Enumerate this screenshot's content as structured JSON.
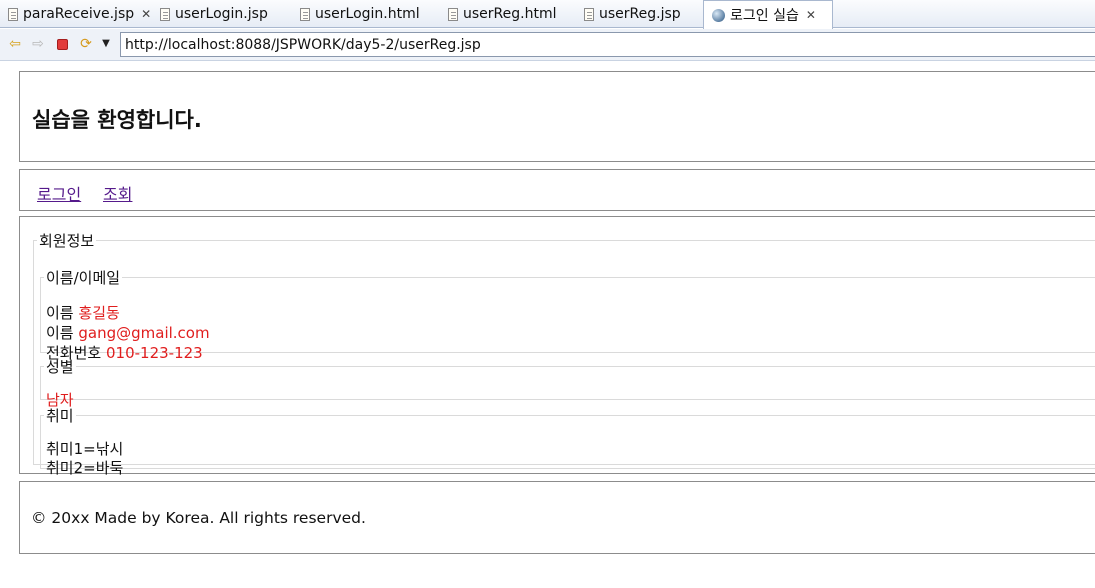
{
  "tabs": [
    {
      "label": "paraReceive.jsp",
      "icon": "file-icon",
      "closable": true,
      "active": false
    },
    {
      "label": "userLogin.jsp",
      "icon": "file-icon",
      "closable": false,
      "active": false
    },
    {
      "label": "userLogin.html",
      "icon": "file-icon",
      "closable": false,
      "active": false
    },
    {
      "label": "userReg.html",
      "icon": "file-icon",
      "closable": false,
      "active": false
    },
    {
      "label": "userReg.jsp",
      "icon": "file-icon",
      "closable": false,
      "active": false
    },
    {
      "label": "로그인 실습",
      "icon": "globe-icon",
      "closable": true,
      "active": true
    }
  ],
  "toolbar": {
    "back_icon": "back-arrow-icon",
    "forward_icon": "forward-arrow-icon",
    "stop_icon": "stop-icon",
    "refresh_icon": "refresh-icon",
    "menu_icon": "dropdown-icon",
    "url": "http://localhost:8088/JSPWORK/day5-2/userReg.jsp"
  },
  "page": {
    "title": "실습을 환영합니다.",
    "nav": {
      "login": "로그인",
      "lookup": "조회"
    },
    "member": {
      "legend": "회원정보",
      "name_email": {
        "legend": "이름/이메일",
        "name_label": "이름",
        "name_value": "홍길동",
        "email_label": "이름",
        "email_value": "gang@gmail.com",
        "phone_label": "전화번호",
        "phone_value": "010-123-123"
      },
      "gender": {
        "legend": "성별",
        "value": "남자"
      },
      "hobby": {
        "legend": "취미",
        "items": [
          "취미1=낚시",
          "취미2=바둑"
        ]
      }
    },
    "footer": "© 20xx Made by Korea. All rights reserved."
  },
  "colors": {
    "value_red": "#e01e1e",
    "link_visited": "#551a8b",
    "border": "#8c8c8c"
  }
}
